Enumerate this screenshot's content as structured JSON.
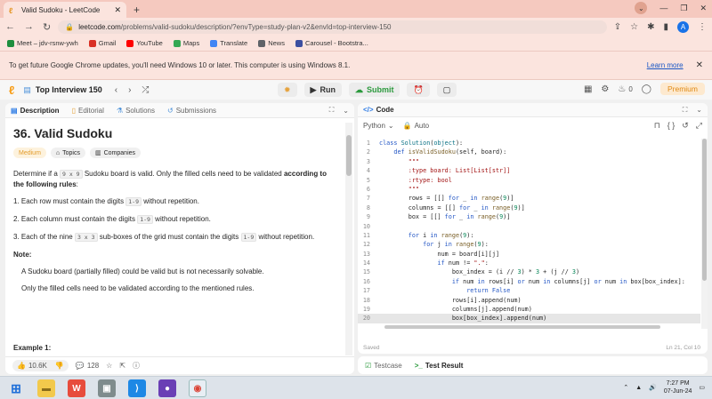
{
  "browser": {
    "tab_title": "Valid Sudoku - LeetCode",
    "url_domain": "leetcode.com",
    "url_path": "/problems/valid-sudoku/description/?envType=study-plan-v2&envId=top-interview-150",
    "avatar_letter": "A",
    "bookmarks": [
      {
        "label": "Meet – jdv-rsnw-ywh",
        "color": "#1e8e3e"
      },
      {
        "label": "Gmail",
        "color": "#d93025"
      },
      {
        "label": "YouTube",
        "color": "#ff0000"
      },
      {
        "label": "Maps",
        "color": "#34a853"
      },
      {
        "label": "Translate",
        "color": "#4285f4"
      },
      {
        "label": "News",
        "color": "#5f6368"
      },
      {
        "label": "Carousel - Bootstra...",
        "color": "#3c4fa0"
      }
    ],
    "infobar_message": "To get future Google Chrome updates, you'll need Windows 10 or later. This computer is using Windows 8.1.",
    "infobar_link": "Learn more"
  },
  "leetcode": {
    "problem_list": "Top Interview 150",
    "run_label": "Run",
    "submit_label": "Submit",
    "fire_count": "0",
    "premium_label": "Premium"
  },
  "left_panel": {
    "tabs": [
      "Description",
      "Editorial",
      "Solutions",
      "Submissions"
    ],
    "title": "36. Valid Sudoku",
    "difficulty": "Medium",
    "topics_label": "Topics",
    "companies_label": "Companies",
    "intro_a": "Determine if a ",
    "intro_code": "9 x 9",
    "intro_b": " Sudoku board is valid. Only the filled cells need to be validated ",
    "intro_bold": "according to the following rules",
    "intro_c": ":",
    "rule1_a": "1. Each row must contain the digits ",
    "rule1_code": "1-9",
    "rule1_b": " without repetition.",
    "rule2_a": "2. Each column must contain the digits ",
    "rule2_code": "1-9",
    "rule2_b": " without repetition.",
    "rule3_a": "3. Each of the nine ",
    "rule3_code": "3 x 3",
    "rule3_b": " sub-boxes of the grid must contain the digits ",
    "rule3_code2": "1-9",
    "rule3_c": " without repetition.",
    "note_label": "Note:",
    "note1": "A Sudoku board (partially filled) could be valid but is not necessarily solvable.",
    "note2": "Only the filled cells need to be validated according to the mentioned rules.",
    "example_label": "Example 1:",
    "likes": "10.6K",
    "comments": "128"
  },
  "right_panel": {
    "title": "Code",
    "language": "Python",
    "auto_label": "Auto",
    "saved_label": "Saved",
    "cursor_pos": "Ln 21, Col 10",
    "testcase_label": "Testcase",
    "test_result_label": "Test Result"
  },
  "taskbar": {
    "time": "7:27 PM",
    "date": "07-Jun-24"
  }
}
